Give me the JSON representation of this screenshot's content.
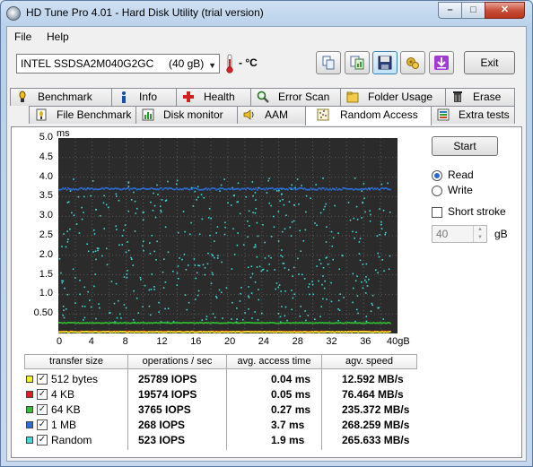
{
  "window": {
    "title": "HD Tune Pro 4.01 - Hard Disk Utility (trial version)"
  },
  "menu": [
    {
      "label": "File"
    },
    {
      "label": "Help"
    }
  ],
  "toolbar": {
    "drive": "INTEL SSDSA2M040G2GC     (40 gB)",
    "temperature": "- °C",
    "icons": [
      "copy-icon",
      "copy-screen-icon",
      "save-icon",
      "options-icon",
      "download-icon"
    ],
    "exit_label": "Exit"
  },
  "tabs_row1": [
    {
      "label": "Benchmark",
      "icon": "benchmark-icon"
    },
    {
      "label": "Info",
      "icon": "info-icon"
    },
    {
      "label": "Health",
      "icon": "health-icon"
    },
    {
      "label": "Error Scan",
      "icon": "error-scan-icon"
    },
    {
      "label": "Folder Usage",
      "icon": "folder-icon"
    },
    {
      "label": "Erase",
      "icon": "erase-icon"
    }
  ],
  "tabs_row2": [
    {
      "label": "File Benchmark",
      "icon": "file-benchmark-icon"
    },
    {
      "label": "Disk monitor",
      "icon": "disk-monitor-icon"
    },
    {
      "label": "AAM",
      "icon": "speaker-icon"
    },
    {
      "label": "Random Access",
      "icon": "random-access-icon",
      "selected": true
    },
    {
      "label": "Extra tests",
      "icon": "extra-tests-icon"
    }
  ],
  "controls": {
    "start_label": "Start",
    "read_label": "Read",
    "write_label": "Write",
    "mode_selected": "Read",
    "short_stroke_label": "Short stroke",
    "short_stroke_checked": false,
    "short_stroke_value": "40",
    "short_stroke_unit": "gB"
  },
  "chart_data": {
    "type": "scatter",
    "y_unit": "ms",
    "ylim": [
      0,
      5.0
    ],
    "y_ticks": [
      "5.0",
      "4.5",
      "4.0",
      "3.5",
      "3.0",
      "2.5",
      "2.0",
      "1.5",
      "1.0",
      "0.50"
    ],
    "xlim": [
      0,
      40
    ],
    "x_ticks": [
      "0",
      "4",
      "8",
      "12",
      "16",
      "20",
      "24",
      "28",
      "32",
      "36",
      "40gB"
    ],
    "series": [
      {
        "name": "512 bytes",
        "color": "#f2f22a",
        "level_ms": 0.04
      },
      {
        "name": "4 KB",
        "color": "#e0201f",
        "level_ms": 0.05
      },
      {
        "name": "64 KB",
        "color": "#30c030",
        "level_ms": 0.27
      },
      {
        "name": "1 MB",
        "color": "#2a6fd8",
        "level_ms": 3.7
      },
      {
        "name": "Random",
        "color": "#40d8d8",
        "level_ms": 1.9,
        "spread": [
          0.3,
          4.0
        ]
      }
    ]
  },
  "results": {
    "headers": [
      "transfer size",
      "operations / sec",
      "avg. access time",
      "agv. speed"
    ],
    "rows": [
      {
        "size": "512 bytes",
        "color": "#f2f22a",
        "ops": "25789 IOPS",
        "access": "0.04 ms",
        "speed": "12.592 MB/s"
      },
      {
        "size": "4 KB",
        "color": "#e0201f",
        "ops": "19574 IOPS",
        "access": "0.05 ms",
        "speed": "76.464 MB/s"
      },
      {
        "size": "64 KB",
        "color": "#30c030",
        "ops": "3765 IOPS",
        "access": "0.27 ms",
        "speed": "235.372 MB/s"
      },
      {
        "size": "1 MB",
        "color": "#2a6fd8",
        "ops": "268 IOPS",
        "access": "3.7 ms",
        "speed": "268.259 MB/s"
      },
      {
        "size": "Random",
        "color": "#40d8d8",
        "ops": "523 IOPS",
        "access": "1.9 ms",
        "speed": "265.633 MB/s"
      }
    ]
  }
}
